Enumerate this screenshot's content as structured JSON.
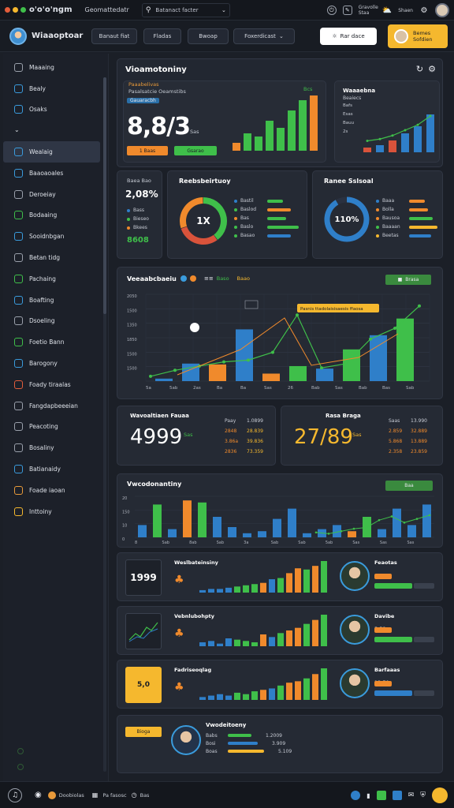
{
  "topbar": {
    "brand": "o'o'o'ngm",
    "crumb": "Geomattedatr",
    "search_text": "Batanact facter",
    "right_label_1": "Gravolle",
    "right_label_2": "Staa",
    "right_label_3": "Shaen"
  },
  "header": {
    "title": "Wiaaoptoar",
    "pill1": "Banaut fiat",
    "pill2": "Fladas",
    "pill3": "Bwoap",
    "dropdown": "Foxerdicast",
    "white_button": "Rar dace",
    "yellow_button_line1": "Bemes",
    "yellow_button_line2": "Sofdien"
  },
  "sidebar": {
    "items": [
      {
        "label": "Maaaing",
        "icon": "home-icon",
        "color": "#9aa0ab"
      },
      {
        "label": "Bealy",
        "icon": "globe-icon",
        "color": "#3a9bdc"
      },
      {
        "label": "Osaks",
        "icon": "grid-icon",
        "color": "#3a9bdc"
      },
      {
        "label": "",
        "icon": "chevron-down-icon",
        "color": "#9aa0ab"
      },
      {
        "label": "Wealaig",
        "icon": "layers-icon",
        "color": "#3a9bdc"
      },
      {
        "label": "Baaoaoales",
        "icon": "database-icon",
        "color": "#3a9bdc"
      },
      {
        "label": "Deroeiay",
        "icon": "folder-icon",
        "color": "#9aa0ab"
      },
      {
        "label": "Bodaaing",
        "icon": "chat-icon",
        "color": "#3fbf4a"
      },
      {
        "label": "Sooidnbgan",
        "icon": "people-icon",
        "color": "#3a9bdc"
      },
      {
        "label": "Betan tidg",
        "icon": "cog-icon",
        "color": "#9aa0ab"
      },
      {
        "label": "Pachaing",
        "icon": "shield-icon",
        "color": "#3fbf4a"
      },
      {
        "label": "Boafting",
        "icon": "image-icon",
        "color": "#3a9bdc"
      },
      {
        "label": "Dsoeling",
        "icon": "mail-icon",
        "color": "#9aa0ab"
      },
      {
        "label": "Foetio Bann",
        "icon": "check-icon",
        "color": "#3fbf4a"
      },
      {
        "label": "Barogony",
        "icon": "cart-icon",
        "color": "#3a9bdc"
      },
      {
        "label": "Foady tiraalas",
        "icon": "flame-icon",
        "color": "#e35d3b"
      },
      {
        "label": "Fangdapbeeeian",
        "icon": "monitor-icon",
        "color": "#9aa0ab"
      },
      {
        "label": "Peacoting",
        "icon": "calendar-icon",
        "color": "#9aa0ab"
      },
      {
        "label": "Bosaliny",
        "icon": "star-icon",
        "color": "#9aa0ab"
      },
      {
        "label": "Batianaidy",
        "icon": "location-icon",
        "color": "#3a9bdc"
      },
      {
        "label": "Foade iaoan",
        "icon": "chef-icon",
        "color": "#e89a3a"
      },
      {
        "label": "Inttoiny",
        "icon": "book-icon",
        "color": "#f5b82e"
      }
    ]
  },
  "kpi_main": {
    "title": "Vioamotoniny",
    "subtitle": "Paaabelivas",
    "detail": "Pasalsatcie Oeamstibs",
    "tag": "Gauaracbh",
    "value": "8,8/3",
    "unit": "Sas",
    "button1": "1 Baas",
    "button2": "Gsarao",
    "bar_label": "Bcs",
    "bar_values": [
      15,
      35,
      28,
      60,
      45,
      80,
      100,
      110
    ]
  },
  "kpi_small": {
    "title": "Waaaebna",
    "subtitle": "Beaiecs",
    "ticks": [
      "Bafs",
      "Esas",
      "Bauu",
      "2s"
    ],
    "bar_values": [
      10,
      15,
      25,
      40,
      55,
      80
    ]
  },
  "stat_left": {
    "label": "Baea Bao",
    "value": "2,08%",
    "rows": [
      "Bass",
      "Bieseo",
      "Bkees"
    ],
    "amount": "8608"
  },
  "donut1": {
    "title": "Reebsbeirtuoy",
    "center": "1X",
    "legend": [
      "Bastil",
      "Baslod",
      "Bas",
      "Baslo",
      "Basao"
    ],
    "values": [
      40,
      30,
      30
    ]
  },
  "donut2": {
    "title": "Ranee Sslsoal",
    "center": "110%",
    "legend": [
      "Baaa",
      "Bolla",
      "Bausoa",
      "Baaaan",
      "Beetas"
    ],
    "values": [
      92,
      8
    ]
  },
  "main_chart": {
    "title": "Veeaabcbaeiu",
    "legend": [
      "Baso",
      "Baao"
    ],
    "badge": "Brasa",
    "tooltip": "Pasnis ttadolaisisaesis ffaosa",
    "y_ticks": [
      "2050",
      "1500",
      "1350",
      "1850",
      "1500",
      "1500"
    ],
    "x_ticks": [
      "5a",
      "5ab",
      "2as",
      "Ba",
      "Ba",
      "Sas",
      "26",
      "Bab",
      "Sas",
      "Bab",
      "Bas",
      "Sab"
    ],
    "bar_values": [
      30,
      210,
      200,
      620,
      90,
      180,
      150,
      380,
      550,
      750
    ],
    "line_values": [
      80,
      180,
      250,
      320,
      350,
      480,
      1100,
      220,
      290,
      700,
      880,
      1250
    ]
  },
  "metric_left": {
    "title": "Wavoaltiaen Fauaa",
    "value": "4999",
    "suffix": "Sas",
    "rows": [
      {
        "label": "Paay",
        "value": "1.0899"
      },
      {
        "label": "2848",
        "value": "28.839"
      },
      {
        "label": "3.86a",
        "value": "39.836"
      },
      {
        "label": "2836",
        "value": "73.359"
      }
    ]
  },
  "metric_right": {
    "title": "Rasa Braga",
    "value": "27/89",
    "suffix": "Sas",
    "rows": [
      {
        "label": "Saas",
        "value": "13.990"
      },
      {
        "label": "2.859",
        "value": "32.889"
      },
      {
        "label": "5.868",
        "value": "13.889"
      },
      {
        "label": "2.358",
        "value": "23.859"
      }
    ]
  },
  "wide_chart": {
    "title": "Vwcodonantiny",
    "badge": "Baa",
    "y_ticks": [
      "20",
      "150",
      "10",
      "0"
    ],
    "x_ticks": [
      "8",
      "Sab",
      "8ab",
      "Sab",
      "3a",
      "Sab",
      "Sab",
      "5ab",
      "Sas",
      "Sas",
      "Sas"
    ],
    "bar_values": [
      30,
      80,
      20,
      90,
      85,
      50,
      25,
      10,
      15,
      45,
      70,
      10,
      20,
      30,
      15,
      50,
      20,
      70,
      30,
      80
    ],
    "line_values": [
      20,
      15,
      25,
      35,
      40,
      70,
      85,
      60,
      75,
      90
    ]
  },
  "rows": [
    {
      "left_label": "1999",
      "title": "Weslbateinsiny",
      "name": "Feaotas",
      "stat": "",
      "bar_values": [
        10,
        15,
        15,
        20,
        25,
        30,
        35,
        40,
        55,
        60,
        80,
        100,
        95,
        110,
        130
      ]
    },
    {
      "left_label": "",
      "title": "Vebnlubohpty",
      "name": "Davibe",
      "stat": "5.58",
      "bar_values": [
        15,
        20,
        10,
        30,
        25,
        20,
        15,
        45,
        35,
        50,
        60,
        70,
        85,
        100,
        120
      ]
    },
    {
      "left_label": "5,0",
      "title": "Fadriseoqlag",
      "name": "Barfaaas",
      "stat": "13,70",
      "bar_values": [
        10,
        15,
        20,
        15,
        25,
        20,
        30,
        35,
        40,
        50,
        60,
        65,
        75,
        90,
        110
      ]
    }
  ],
  "last_card": {
    "badge": "Bioga",
    "title": "Vwodeitoeny",
    "rows": [
      "Babs",
      "Bosi",
      "Boas"
    ],
    "values": [
      "1.2009",
      "3.909",
      "5.109"
    ]
  },
  "bottombar": {
    "label1": "Doobiolas",
    "label2": "Pa fasosc",
    "label3": "Bas"
  },
  "colors": {
    "green": "#3fbf4a",
    "blue": "#2f7fc9",
    "orange": "#f08a2c",
    "yellow": "#f5b82e",
    "red": "#d9533b"
  }
}
